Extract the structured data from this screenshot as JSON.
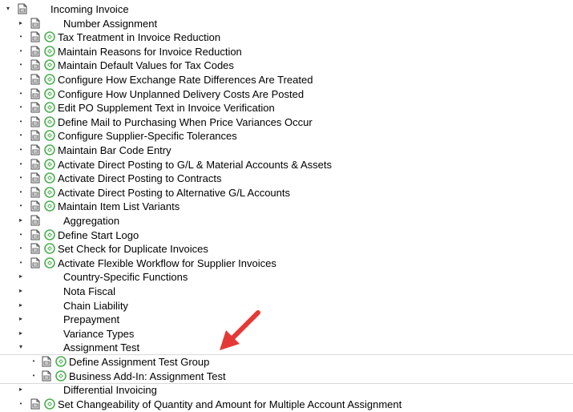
{
  "tree": {
    "top_partial_label": "",
    "rows": [
      {
        "label": "Incoming Invoice",
        "level": 0,
        "expander": "expanded",
        "doc": true,
        "exec": false
      },
      {
        "label": "Number Assignment",
        "level": 1,
        "expander": "collapsed",
        "doc": true,
        "exec": false
      },
      {
        "label": "Tax Treatment in Invoice Reduction",
        "level": 1,
        "expander": "leaf",
        "doc": true,
        "exec": true
      },
      {
        "label": "Maintain Reasons for Invoice Reduction",
        "level": 1,
        "expander": "leaf",
        "doc": true,
        "exec": true
      },
      {
        "label": "Maintain Default Values for Tax Codes",
        "level": 1,
        "expander": "leaf",
        "doc": true,
        "exec": true
      },
      {
        "label": "Configure How Exchange Rate Differences Are Treated",
        "level": 1,
        "expander": "leaf",
        "doc": true,
        "exec": true
      },
      {
        "label": "Configure How Unplanned Delivery Costs Are Posted",
        "level": 1,
        "expander": "leaf",
        "doc": true,
        "exec": true
      },
      {
        "label": "Edit PO Supplement Text in Invoice Verification",
        "level": 1,
        "expander": "leaf",
        "doc": true,
        "exec": true
      },
      {
        "label": "Define Mail to Purchasing When Price Variances Occur",
        "level": 1,
        "expander": "leaf",
        "doc": true,
        "exec": true
      },
      {
        "label": "Configure Supplier-Specific Tolerances",
        "level": 1,
        "expander": "leaf",
        "doc": true,
        "exec": true
      },
      {
        "label": "Maintain Bar Code Entry",
        "level": 1,
        "expander": "leaf",
        "doc": true,
        "exec": true
      },
      {
        "label": "Activate Direct Posting to G/L & Material Accounts & Assets",
        "level": 1,
        "expander": "leaf",
        "doc": true,
        "exec": true
      },
      {
        "label": "Activate Direct Posting to Contracts",
        "level": 1,
        "expander": "leaf",
        "doc": true,
        "exec": true
      },
      {
        "label": "Activate Direct Posting to Alternative G/L Accounts",
        "level": 1,
        "expander": "leaf",
        "doc": true,
        "exec": true
      },
      {
        "label": "Maintain Item List Variants",
        "level": 1,
        "expander": "leaf",
        "doc": true,
        "exec": true
      },
      {
        "label": "Aggregation",
        "level": 1,
        "expander": "collapsed",
        "doc": true,
        "exec": false
      },
      {
        "label": "Define Start Logo",
        "level": 1,
        "expander": "leaf",
        "doc": true,
        "exec": true
      },
      {
        "label": "Set Check for Duplicate Invoices",
        "level": 1,
        "expander": "leaf",
        "doc": true,
        "exec": true
      },
      {
        "label": "Activate Flexible Workflow for Supplier Invoices",
        "level": 1,
        "expander": "leaf",
        "doc": true,
        "exec": true
      },
      {
        "label": "Country-Specific Functions",
        "level": 1,
        "expander": "collapsed",
        "doc": false,
        "exec": false
      },
      {
        "label": "Nota Fiscal",
        "level": 1,
        "expander": "collapsed",
        "doc": false,
        "exec": false
      },
      {
        "label": "Chain Liability",
        "level": 1,
        "expander": "collapsed",
        "doc": false,
        "exec": false
      },
      {
        "label": "Prepayment",
        "level": 1,
        "expander": "collapsed",
        "doc": false,
        "exec": false
      },
      {
        "label": "Variance Types",
        "level": 1,
        "expander": "collapsed",
        "doc": false,
        "exec": false
      },
      {
        "label": "Assignment Test",
        "level": 1,
        "expander": "expanded",
        "doc": false,
        "exec": false
      },
      {
        "label": "Define Assignment Test Group",
        "level": 2,
        "expander": "leaf",
        "doc": true,
        "exec": true
      },
      {
        "label": "Business Add-In: Assignment Test",
        "level": 2,
        "expander": "leaf",
        "doc": true,
        "exec": true
      },
      {
        "label": "Differential Invoicing",
        "level": 1,
        "expander": "collapsed",
        "doc": false,
        "exec": false
      },
      {
        "label": "Set Changeability of Quantity and Amount for Multiple Account Assignment",
        "level": 1,
        "expander": "leaf",
        "doc": true,
        "exec": true
      }
    ]
  },
  "icons": {
    "doc": "documentation-icon",
    "exec": "execute-clock-icon",
    "expanded": "tree-expanded-icon",
    "collapsed": "tree-collapsed-icon",
    "leaf": "tree-leaf-bullet-icon"
  },
  "colors": {
    "exec_icon": "#4caf50",
    "doc_icon_border": "#4a4a4a",
    "annotation_arrow": "#e53935",
    "separator": "#d9d9d9"
  }
}
